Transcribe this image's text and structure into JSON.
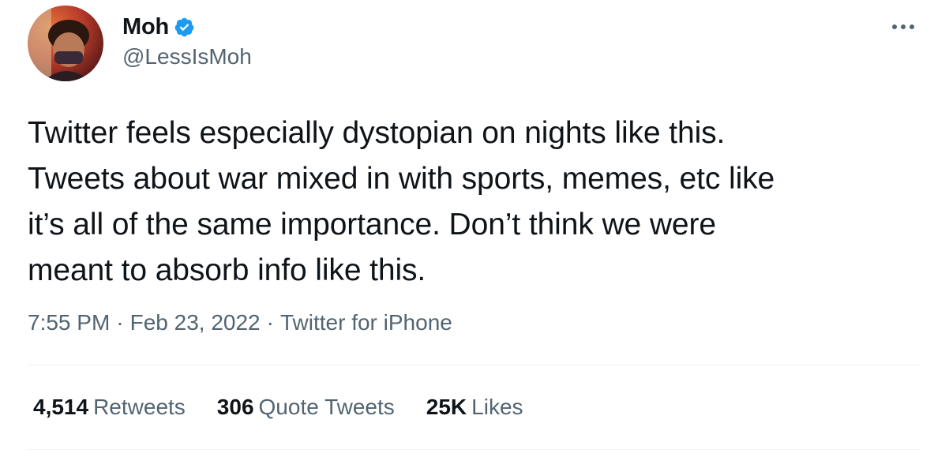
{
  "author": {
    "display_name": "Moh",
    "handle": "@LessIsMoh",
    "verified": true,
    "verified_color": "#1d9bf0"
  },
  "tweet": {
    "text": "Twitter feels especially dystopian on nights like this.\nTweets about war mixed in with sports, memes, etc like\nit’s all of the same importance. Don’t think we were\nmeant to absorb info like this.",
    "time": "7:55 PM",
    "separator": "·",
    "date": "Feb 23, 2022",
    "source": "Twitter for iPhone"
  },
  "stats": {
    "retweets": {
      "count": "4,514",
      "label": "Retweets"
    },
    "quote_tweets": {
      "count": "306",
      "label": "Quote Tweets"
    },
    "likes": {
      "count": "25K",
      "label": "Likes"
    }
  },
  "icons": {
    "more": "more-horizontal-icon",
    "verified": "verified-badge-icon"
  },
  "colors": {
    "primary_text": "#0f1419",
    "secondary_text": "#536471",
    "divider": "#eff3f4"
  }
}
